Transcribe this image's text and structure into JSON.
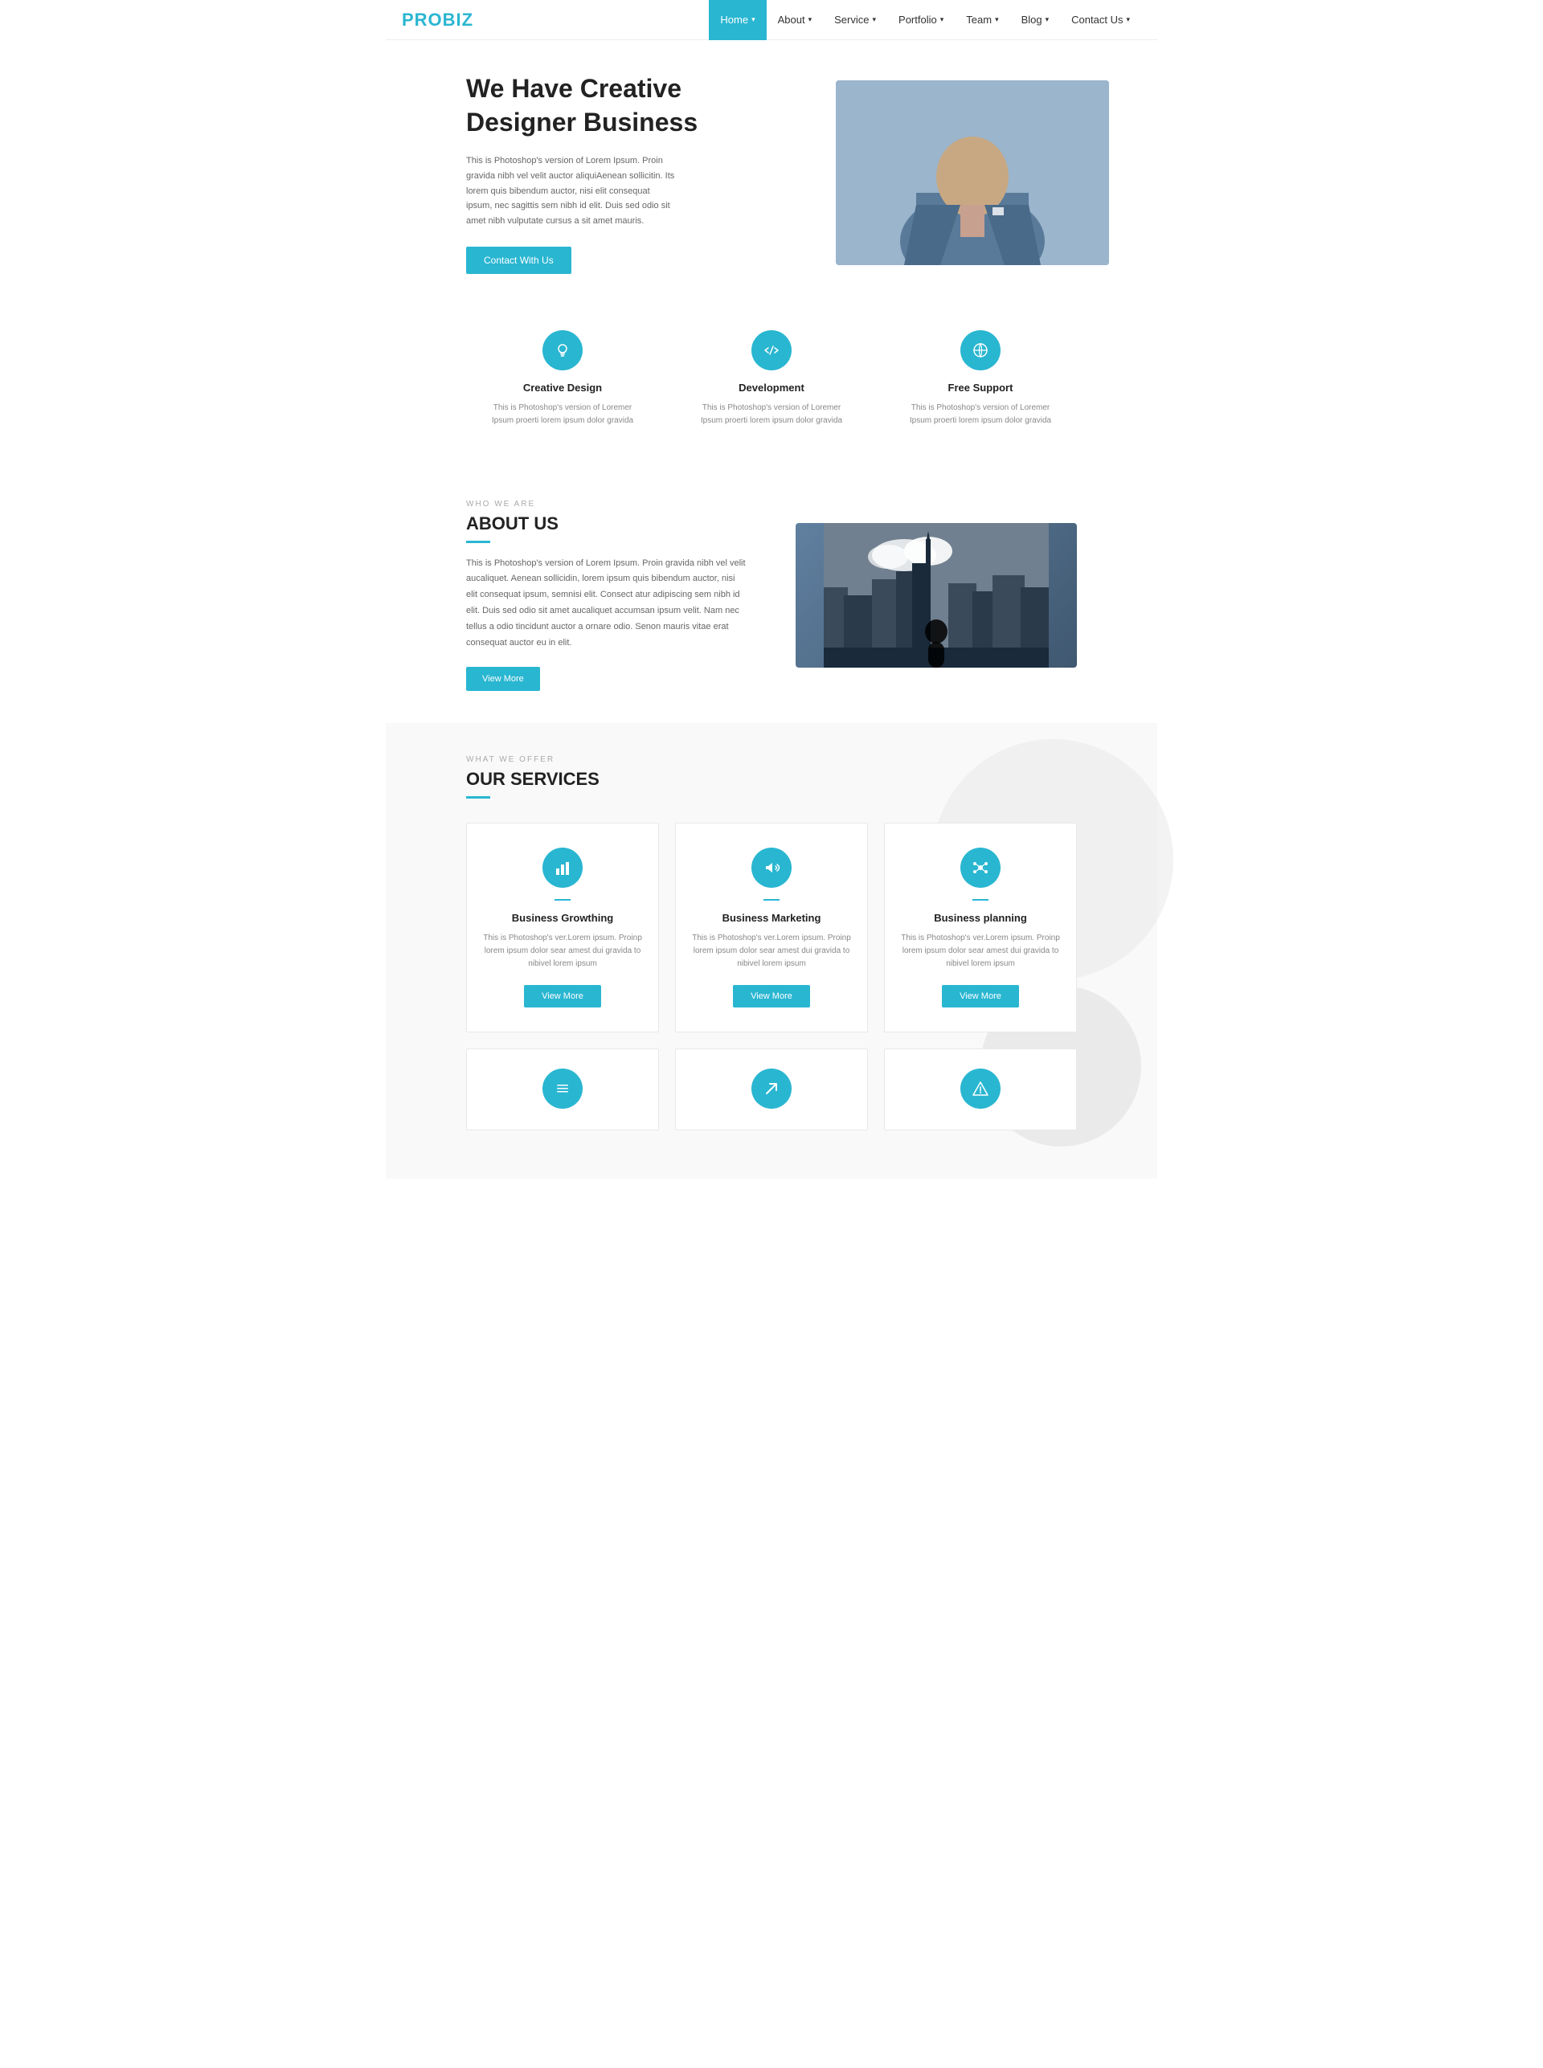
{
  "brand": "PROBIZ",
  "nav": {
    "items": [
      {
        "label": "Home",
        "active": true,
        "arrow": true
      },
      {
        "label": "About",
        "active": false,
        "arrow": true
      },
      {
        "label": "Service",
        "active": false,
        "arrow": true
      },
      {
        "label": "Portfolio",
        "active": false,
        "arrow": true
      },
      {
        "label": "Team",
        "active": false,
        "arrow": true
      },
      {
        "label": "Blog",
        "active": false,
        "arrow": true
      },
      {
        "label": "Contact Us",
        "active": false,
        "arrow": true
      }
    ]
  },
  "hero": {
    "title_line1": "We Have Creative",
    "title_line2": "Designer Business",
    "description": "This is Photoshop's version of Lorem Ipsum. Proin gravida nibh vel velit auctor aliquiAenean sollicitin. Its lorem quis bibendum auctor, nisi elit consequat ipsum, nec sagittis sem nibh id elit. Duis sed odio sit amet nibh vulputate cursus a sit amet mauris.",
    "cta_label": "Contact With Us"
  },
  "features": [
    {
      "icon": "💡",
      "title": "Creative Design",
      "description": "This is Photoshop's version of Loremer Ipsum proerti lorem ipsum dolor gravida"
    },
    {
      "icon": "</>",
      "title": "Development",
      "description": "This is Photoshop's version of Loremer Ipsum proerti lorem ipsum dolor gravida"
    },
    {
      "icon": "🌐",
      "title": "Free Support",
      "description": "This is Photoshop's version of Loremer Ipsum proerti lorem ipsum dolor gravida"
    }
  ],
  "about": {
    "label": "WHO WE ARE",
    "title": "ABOUT US",
    "description": "This is Photoshop's version of Lorem Ipsum. Proin gravida nibh vel velit aucaliquet. Aenean sollicidin, lorem ipsum quis bibendum auctor, nisi elit consequat ipsum, semnisi elit. Consect atur adipiscing sem nibh id elit. Duis sed odio sit amet aucaliquet accumsan ipsum velit. Nam nec tellus a odio tincidunt auctor a ornare odio. Senon mauris vitae erat consequat auctor eu in elit.",
    "view_more_label": "View More"
  },
  "services": {
    "label": "WHAT WE OFFER",
    "title": "OUR SERVICES",
    "cards": [
      {
        "icon": "📊",
        "title": "Business Growthing",
        "description": "This is Photoshop's ver.Lorem ipsum. Proinp lorem ipsum dolor sear amest dui gravida to nibivel lorem ipsum",
        "btn_label": "View More"
      },
      {
        "icon": "📢",
        "title": "Business Marketing",
        "description": "This is Photoshop's ver.Lorem ipsum. Proinp lorem ipsum dolor sear amest dui gravida to nibivel lorem ipsum",
        "btn_label": "View More"
      },
      {
        "icon": "🔗",
        "title": "Business planning",
        "description": "This is Photoshop's ver.Lorem ipsum. Proinp lorem ipsum dolor sear amest dui gravida to nibivel lorem ipsum",
        "btn_label": "View More"
      }
    ],
    "partial_icons": [
      "☰",
      "➤",
      "⚠"
    ]
  }
}
